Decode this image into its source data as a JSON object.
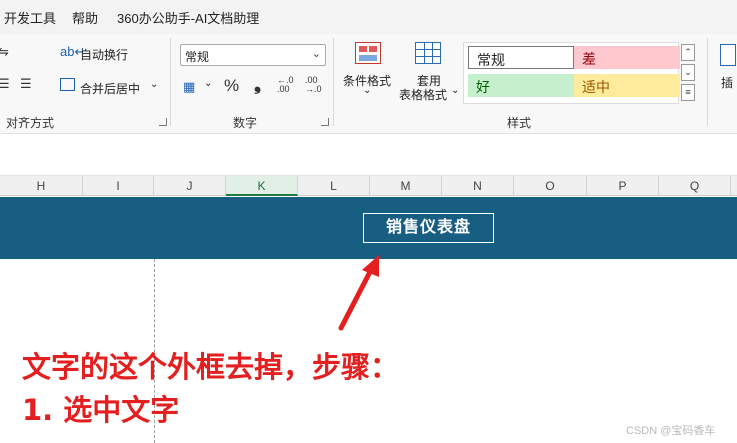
{
  "menu": {
    "items": [
      "开发工具",
      "帮助",
      "360办公助手-AI文档助理"
    ]
  },
  "ribbon": {
    "alignment": {
      "wrap_text_label": "自动换行",
      "merge_center_label": "合并后居中",
      "group_label": "对齐方式"
    },
    "number": {
      "format_value": "常规",
      "percent_symbol": "%",
      "comma_symbol": "❟",
      "increase_decimal": "←.0\n.00",
      "decrease_decimal": ".00\n→.0",
      "group_label": "数字"
    },
    "styles": {
      "conditional_format_label": "条件格式",
      "table_format_label_1": "套用",
      "table_format_label_2": "表格格式",
      "cells": [
        {
          "label": "常规",
          "bg": "#ffffff",
          "fg": "#222222",
          "border": "#7a7a7a"
        },
        {
          "label": "差",
          "bg": "#ffc7ce",
          "fg": "#9c0006"
        },
        {
          "label": "好",
          "bg": "#c6efce",
          "fg": "#006100"
        },
        {
          "label": "适中",
          "bg": "#ffeb9c",
          "fg": "#9c5700"
        }
      ],
      "group_label": "样式"
    },
    "insert_label": "插"
  },
  "columns": [
    "H",
    "I",
    "J",
    "K",
    "L",
    "M",
    "N",
    "O",
    "P",
    "Q"
  ],
  "selected_column": "K",
  "banner": {
    "title": "销售仪表盘",
    "bg_color": "#185e82"
  },
  "annotation": {
    "line1": "文字的这个外框去掉，步骤：",
    "line2": "1. 选中文字",
    "color": "#e41f1f"
  },
  "watermark": "CSDN @宝码香车"
}
